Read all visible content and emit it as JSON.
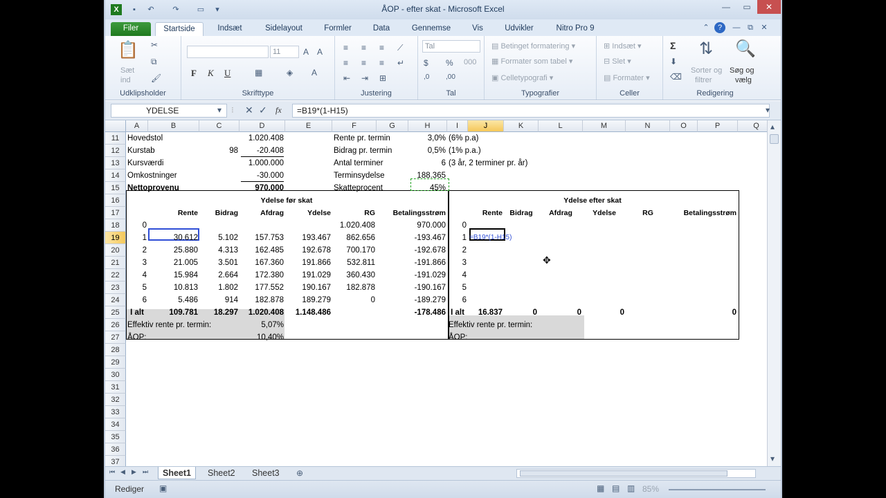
{
  "window": {
    "title": "ÅOP - efter skat  -  Microsoft Excel"
  },
  "tabs": [
    "Filer",
    "Startside",
    "Indsæt",
    "Sidelayout",
    "Formler",
    "Data",
    "Gennemse",
    "Vis",
    "Udvikler",
    "Nitro Pro 9"
  ],
  "ribbon": {
    "clipboard": {
      "paste": "Sæt",
      "paste2": "ind",
      "label": "Udklipsholder"
    },
    "font": {
      "size": "11",
      "bold": "F",
      "italic": "K",
      "underline": "U",
      "label": "Skrifttype"
    },
    "alignment": {
      "label": "Justering"
    },
    "number": {
      "format": "Tal",
      "label": "Tal",
      "thousands": "000"
    },
    "styles": {
      "conditional": "Betinget formatering",
      "table": "Formater som tabel",
      "cell": "Celletypografi",
      "label": "Typografier"
    },
    "cells": {
      "insert": "Indsæt",
      "delete": "Slet",
      "format": "Formater",
      "label": "Celler"
    },
    "editing": {
      "sum": "Σ",
      "sort": "Sorter og",
      "sort2": "filtrer",
      "find": "Søg og",
      "find2": "vælg",
      "label": "Redigering"
    }
  },
  "formula_bar": {
    "name": "YDELSE",
    "formula": "=B19*(1-H15)",
    "fx": "fx"
  },
  "columns": [
    "A",
    "B",
    "C",
    "D",
    "E",
    "F",
    "G",
    "H",
    "I",
    "J",
    "K",
    "L",
    "M",
    "N",
    "O",
    "P",
    "Q"
  ],
  "rows": [
    "11",
    "12",
    "13",
    "14",
    "15",
    "16",
    "17",
    "18",
    "19",
    "20",
    "21",
    "22",
    "23",
    "24",
    "25",
    "26",
    "27",
    "28",
    "29",
    "30",
    "31",
    "32",
    "33",
    "34",
    "35",
    "36",
    "37"
  ],
  "cells": {
    "a11": "Hovedstol",
    "d11": "1.020.408",
    "f11": "Rente pr. termin",
    "h11": "3,0%",
    "i11": "(6% p.a)",
    "a12": "Kurstab",
    "c12": "98",
    "d12": "-20.408",
    "f12": "Bidrag pr. termin",
    "h12": "0,5%",
    "i12": "(1% p.a.)",
    "a13": "Kursværdi",
    "d13": "1.000.000",
    "f13": "Antal terminer",
    "h13": "6",
    "i13": "(3 år, 2 terminer pr. år)",
    "a14": "Omkostninger",
    "d14": "-30.000",
    "f14": "Terminsydelse",
    "h14": "188.365",
    "a15": "Nettoprovenu",
    "d15": "970.000",
    "f15": "Skatteprocent",
    "h15": "45%",
    "title_left": "Ydelse før skat",
    "title_right": "Ydelse efter skat",
    "hdr": [
      "Rente",
      "Bidrag",
      "Afdrag",
      "Ydelse",
      "RG",
      "Betalingsstrøm"
    ],
    "r18": {
      "a": "0",
      "f": "1.020.408",
      "h": "970.000",
      "i": "0"
    },
    "r19": {
      "a": "1",
      "b": "30.612",
      "c": "5.102",
      "d": "157.753",
      "e": "193.467",
      "f": "862.656",
      "h": "-193.467",
      "i": "1",
      "j": "=B19*(1-H15)"
    },
    "r20": {
      "a": "2",
      "b": "25.880",
      "c": "4.313",
      "d": "162.485",
      "e": "192.678",
      "f": "700.170",
      "h": "-192.678",
      "i": "2"
    },
    "r21": {
      "a": "3",
      "b": "21.005",
      "c": "3.501",
      "d": "167.360",
      "e": "191.866",
      "f": "532.811",
      "h": "-191.866",
      "i": "3"
    },
    "r22": {
      "a": "4",
      "b": "15.984",
      "c": "2.664",
      "d": "172.380",
      "e": "191.029",
      "f": "360.430",
      "h": "-191.029",
      "i": "4"
    },
    "r23": {
      "a": "5",
      "b": "10.813",
      "c": "1.802",
      "d": "177.552",
      "e": "190.167",
      "f": "182.878",
      "h": "-190.167",
      "i": "5"
    },
    "r24": {
      "a": "6",
      "b": "5.486",
      "c": "914",
      "d": "182.878",
      "e": "189.279",
      "f": "0",
      "h": "-189.279",
      "i": "6"
    },
    "r25": {
      "a": "I alt",
      "b": "109.781",
      "c": "18.297",
      "d": "1.020.408",
      "e": "1.148.486",
      "h": "-178.486",
      "i": "I alt",
      "j": "16.837",
      "k": "0",
      "l": "0",
      "m": "0",
      "p": "0"
    },
    "r26": {
      "a": "Effektiv rente pr. termin:",
      "d": "5,07%",
      "i": "Effektiv rente pr. termin:"
    },
    "r27": {
      "a": "ÅOP:",
      "d": "10,40%",
      "i": "ÅOP:"
    }
  },
  "sheets": [
    "Sheet1",
    "Sheet2",
    "Sheet3"
  ],
  "status": {
    "mode": "Rediger",
    "zoom": "85%"
  }
}
